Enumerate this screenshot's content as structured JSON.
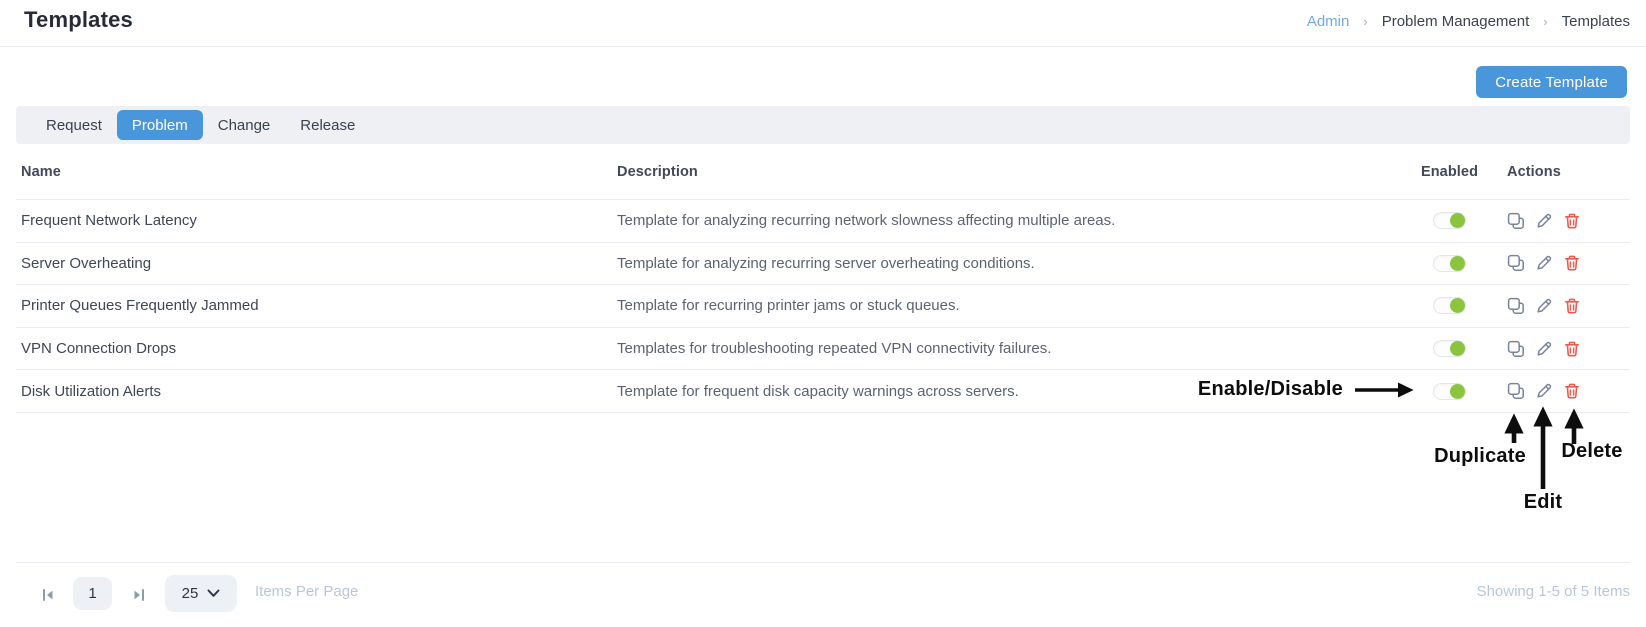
{
  "page": {
    "title": "Templates"
  },
  "breadcrumb": {
    "separator": "›",
    "items": [
      {
        "label": "Admin"
      },
      {
        "label": "Problem Management"
      },
      {
        "label": "Templates"
      }
    ]
  },
  "toolbar": {
    "create_label": "Create Template"
  },
  "tabs": [
    {
      "label": "Request",
      "active": false
    },
    {
      "label": "Problem",
      "active": true
    },
    {
      "label": "Change",
      "active": false
    },
    {
      "label": "Release",
      "active": false
    }
  ],
  "table": {
    "columns": [
      "Name",
      "Description",
      "Enabled",
      "Actions"
    ],
    "rows": [
      {
        "name": "Frequent Network Latency",
        "description": "Template for analyzing recurring network slowness affecting multiple areas.",
        "enabled": true
      },
      {
        "name": "Server Overheating",
        "description": "Template for analyzing recurring server overheating conditions.",
        "enabled": true
      },
      {
        "name": "Printer Queues Frequently Jammed",
        "description": "Template for recurring printer jams or stuck queues.",
        "enabled": true
      },
      {
        "name": "VPN Connection Drops",
        "description": "Templates for troubleshooting repeated VPN connectivity failures.",
        "enabled": true
      },
      {
        "name": "Disk Utilization Alerts",
        "description": "Template for frequent disk capacity warnings across servers.",
        "enabled": true
      }
    ]
  },
  "annotations": {
    "enable_disable": "Enable/Disable",
    "duplicate": "Duplicate",
    "edit": "Edit",
    "delete": "Delete"
  },
  "pagination": {
    "current_page": "1",
    "items_per_page": "25",
    "items_per_page_label": "Items Per Page",
    "showing": "Showing 1-5 of 5 Items"
  },
  "colors": {
    "accent_blue": "#4a96da",
    "breadcrumb_link": "#71a9e2",
    "toggle_green": "#8bc540",
    "delete_red": "#ed5a50",
    "icon_gray": "#76839a",
    "muted_text": "#b9c6d8"
  }
}
